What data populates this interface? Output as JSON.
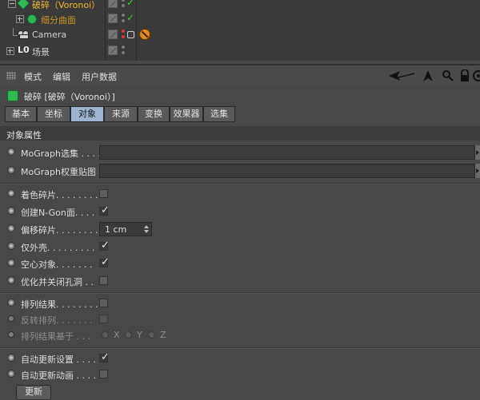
{
  "tree": {
    "items": [
      {
        "label": "破碎（Voronoi）"
      },
      {
        "label": "细分曲面"
      },
      {
        "label": "Camera"
      },
      {
        "label": "场景"
      }
    ]
  },
  "menu": {
    "items": [
      "模式",
      "编辑",
      "用户数据"
    ]
  },
  "header": {
    "object_title": "破碎 [破碎（Voronoi）]"
  },
  "tabs": [
    "基本",
    "坐标",
    "对象",
    "来源",
    "变换",
    "效果器",
    "选集"
  ],
  "active_tab": "对象",
  "section": {
    "title": "对象属性"
  },
  "attributes": {
    "mograph_selection": "MoGraph选集 . . . .",
    "mograph_weight": "MoGraph权重贴图",
    "color_fragments": "着色碎片. . . . . . . .",
    "create_ngon": "创建N-Gon面. . . .",
    "offset_fragments": "偏移碎片. . . . . . . .",
    "offset_value": "1 cm",
    "outer_shell_only": "仅外壳. . . . . . . . .",
    "hollow_object": "空心对象. . . . . . .",
    "optimize_close_holes": "优化并关闭孔洞 . .",
    "sort_results": "排列结果. . . . . . . .",
    "invert_sort": "反转排列. . . . . . .",
    "sort_based_on": "排列结果基于 . . .",
    "axis_x": "X",
    "axis_y": "Y",
    "axis_z": "Z",
    "auto_update_settings": "自动更新设置 . . . .",
    "auto_update_animation": "自动更新动画 . . . ."
  },
  "checked": {
    "color_fragments": false,
    "create_ngon": true,
    "outer_shell_only": true,
    "hollow_object": true,
    "optimize_close_holes": false,
    "sort_results": false,
    "invert_sort": false,
    "auto_update_settings": true,
    "auto_update_animation": false
  },
  "update_button": "更新",
  "colors": {
    "selected_object": "#f2b830",
    "active_tab": "#9db3cf",
    "check_green": "#38d038"
  }
}
